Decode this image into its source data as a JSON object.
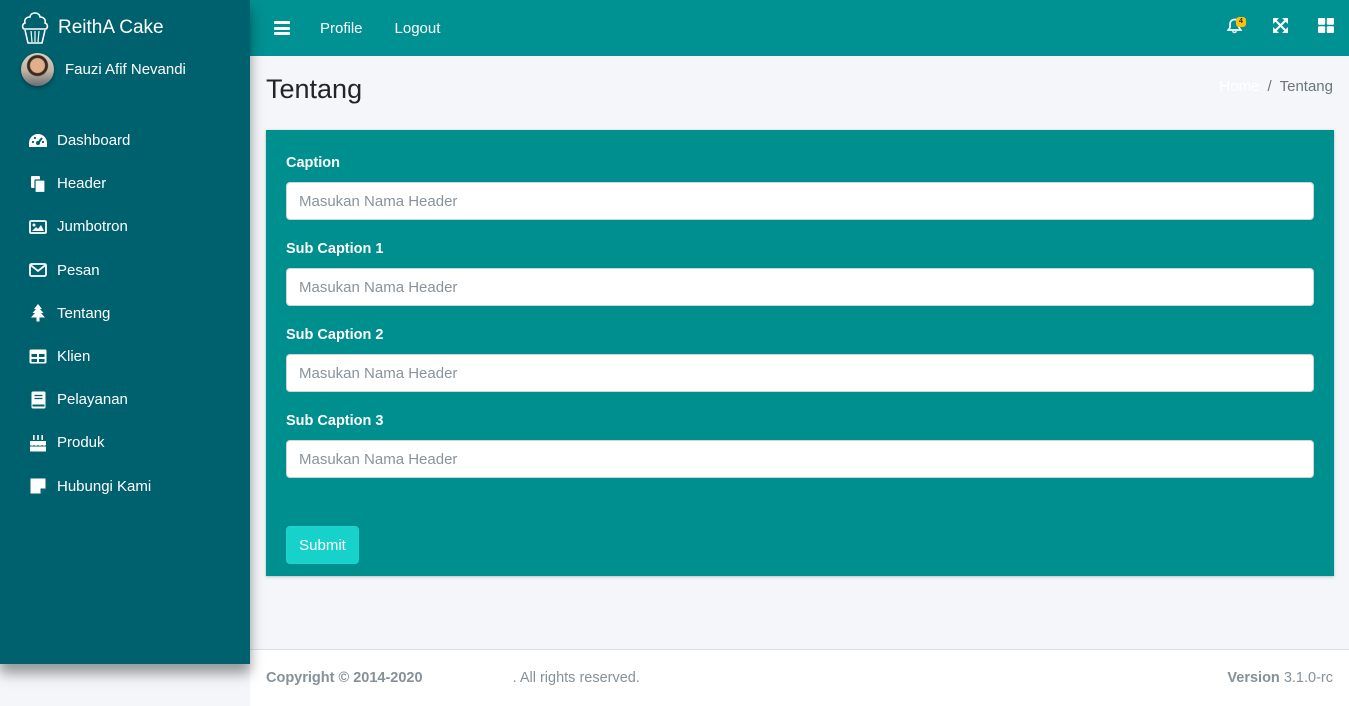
{
  "brand": {
    "name": "ReithA Cake",
    "icon": "cupcake-icon"
  },
  "user": {
    "name": "Fauzi Afif Nevandi"
  },
  "sidebar": {
    "items": [
      {
        "label": "Dashboard",
        "icon": "tachometer-icon"
      },
      {
        "label": "Header",
        "icon": "copy-icon"
      },
      {
        "label": "Jumbotron",
        "icon": "image-icon"
      },
      {
        "label": "Pesan",
        "icon": "envelope-icon"
      },
      {
        "label": "Tentang",
        "icon": "tree-icon"
      },
      {
        "label": "Klien",
        "icon": "table-icon"
      },
      {
        "label": "Pelayanan",
        "icon": "book-icon"
      },
      {
        "label": "Produk",
        "icon": "birthday-cake-icon"
      },
      {
        "label": "Hubungi Kami",
        "icon": "sticky-note-icon"
      }
    ]
  },
  "topbar": {
    "links": [
      "Profile",
      "Logout"
    ],
    "notification_count": "4"
  },
  "page": {
    "title": "Tentang",
    "breadcrumb": {
      "home": "Home",
      "current": "Tentang"
    }
  },
  "form": {
    "fields": [
      {
        "label": "Caption",
        "placeholder": "Masukan Nama Header"
      },
      {
        "label": "Sub Caption 1",
        "placeholder": "Masukan Nama Header"
      },
      {
        "label": "Sub Caption 2",
        "placeholder": "Masukan Nama Header"
      },
      {
        "label": "Sub Caption 3",
        "placeholder": "Masukan Nama Header"
      }
    ],
    "submit_label": "Submit"
  },
  "footer": {
    "copyright": "Copyright © 2014-2020",
    "rights": ". All rights reserved.",
    "version_label": "Version",
    "version_value": "3.1.0-rc"
  },
  "colors": {
    "sidebar": "#00616e",
    "topbar": "#009192",
    "card": "#008f8f",
    "button": "#17d1cb",
    "badge": "#ffc107"
  }
}
